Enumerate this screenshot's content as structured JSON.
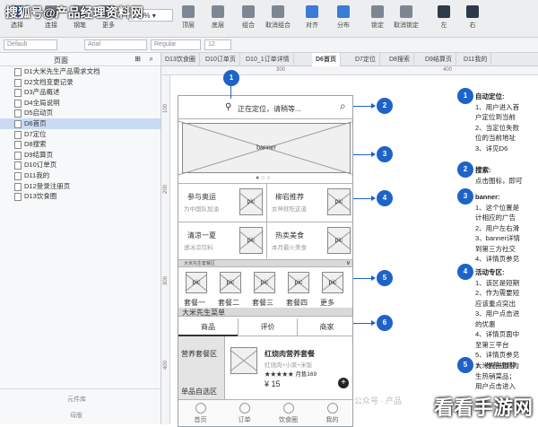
{
  "watermark": "搜狐号@产品经理资料网",
  "toolbar": {
    "zoom": "100%",
    "buttons": [
      {
        "label": "选择"
      },
      {
        "label": "连接"
      },
      {
        "label": "钢笔"
      },
      {
        "label": "更多"
      },
      {
        "label": "顶层"
      },
      {
        "label": "底层"
      },
      {
        "label": "组合"
      },
      {
        "label": "取消组合"
      },
      {
        "label": "对齐"
      },
      {
        "label": "分布"
      },
      {
        "label": "锁定"
      },
      {
        "label": "取消锁定"
      },
      {
        "label": "左"
      },
      {
        "label": "右"
      }
    ]
  },
  "format_bar": {
    "style": "Default",
    "font": "Arial",
    "weight": "Regular",
    "size": "12"
  },
  "sidebar": {
    "header": "页面",
    "pages": [
      "D1大米先生产品需求文档",
      "D2文档变更记录",
      "D3产品概述",
      "D4全局说明",
      "D5启动页",
      "D6首页",
      "D7定位",
      "D8搜索",
      "D9结算页",
      "D10订单页",
      "D11我的",
      "D12登录注册页",
      "D13饮食圈"
    ],
    "active_index": 5,
    "bottom_1": "元件库",
    "bottom_2": "母版"
  },
  "tabs": [
    "D13饮食圈",
    "D10订单页",
    "D10_1订单详情",
    "D6首页",
    "D7定位",
    "D8搜索",
    "D9结算页",
    "D11我的"
  ],
  "active_tab": 3,
  "ruler": {
    "h": [
      "300",
      "400"
    ],
    "v": [
      "100",
      "200",
      "300",
      "400"
    ]
  },
  "phone": {
    "location_text": "正在定位，请稍等...",
    "banner": "banner",
    "promos": [
      {
        "title": "参与奥运",
        "sub": "为中国队加油"
      },
      {
        "title": "柳岩推荐",
        "sub": "女神就吃这道"
      },
      {
        "title": "清凉一夏",
        "sub": "透冰凉饮料"
      },
      {
        "title": "热卖美食",
        "sub": "本月最火美食"
      }
    ],
    "pic_label": "pic",
    "section_label": "大米先生套餐区",
    "sets": [
      "套餐一",
      "套餐二",
      "套餐三",
      "套餐四",
      "更多"
    ],
    "menu_bar": "大米先生菜单",
    "seg_tabs": [
      "商品",
      "评价",
      "商家"
    ],
    "left_cats": [
      "营养套餐区",
      "单品自选区"
    ],
    "food_name": "红烧肉营养套餐",
    "food_desc": "红烧肉+小菜+米饭",
    "food_sales": "月售169",
    "food_price": "¥ 15",
    "bottom_nav": [
      "首页",
      "订单",
      "饮食圈",
      "我的"
    ]
  },
  "markers": [
    "1",
    "2",
    "3",
    "4",
    "5",
    "6"
  ],
  "notes": [
    {
      "num": "1",
      "lines": [
        "自动定位:",
        "1、用户进入首",
        "户定位到当前",
        "2、当定位失败",
        "位的当前地址",
        "3、详见D6"
      ]
    },
    {
      "num": "2",
      "lines": [
        "搜索:",
        "点击图标，即可"
      ]
    },
    {
      "num": "3",
      "lines": [
        "banner:",
        "1、这个位置是",
        "计相应的广告",
        "2、用户左右滑",
        "3、banner详情",
        "到第三方社交",
        "4、详情页参见"
      ]
    },
    {
      "num": "4",
      "lines": [
        "活动专区:",
        "1、该区是短期",
        "2、作为需要短",
        "应该重点突出",
        "3、用户点击进",
        "的优惠",
        "4、详情页面中",
        "至第三平台",
        "5、详情页参见",
        "大米先生推荐:"
      ]
    },
    {
      "num": "5",
      "lines": [
        "1、推荐规则为",
        "生热销菜品；",
        "用户点击进入"
      ]
    }
  ],
  "brand": "看看手游网",
  "wechat": "公众号 · 产品"
}
